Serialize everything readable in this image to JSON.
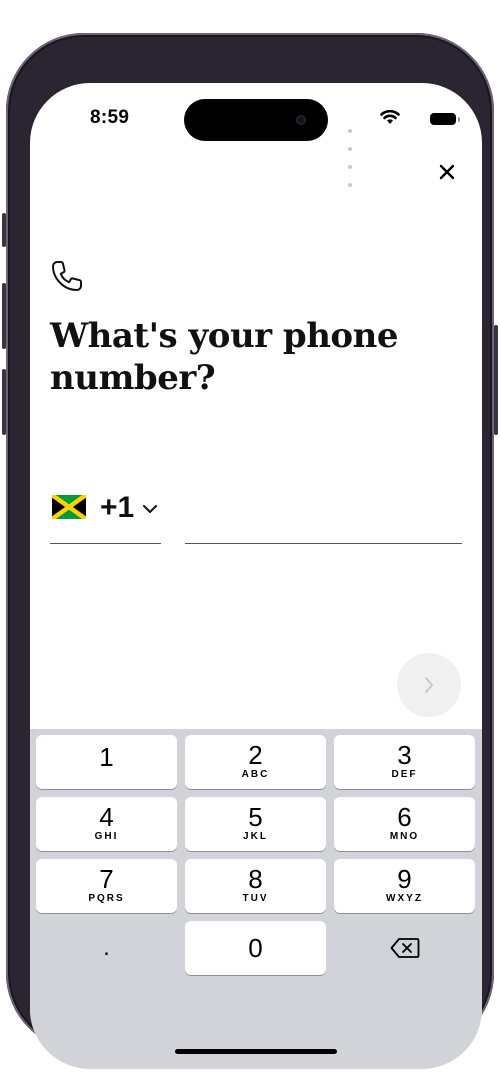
{
  "status_bar": {
    "time": "8:59",
    "icons": [
      "cellular-dots-icon",
      "wifi-icon",
      "battery-icon"
    ]
  },
  "header": {
    "close_icon": "close-icon"
  },
  "main": {
    "icon": "phone-icon",
    "title": "What's your phone number?",
    "country": {
      "flag": "jamaica-flag-icon",
      "dial_code": "+1",
      "chevron": "chevron-down-icon"
    },
    "phone_input": {
      "value": "",
      "placeholder": ""
    },
    "next_button": {
      "icon": "chevron-right-icon",
      "enabled": false
    }
  },
  "keypad": {
    "keys": [
      {
        "num": "1",
        "letters": ""
      },
      {
        "num": "2",
        "letters": "ABC"
      },
      {
        "num": "3",
        "letters": "DEF"
      },
      {
        "num": "4",
        "letters": "GHI"
      },
      {
        "num": "5",
        "letters": "JKL"
      },
      {
        "num": "6",
        "letters": "MNO"
      },
      {
        "num": "7",
        "letters": "PQRS"
      },
      {
        "num": "8",
        "letters": "TUV"
      },
      {
        "num": "9",
        "letters": "WXYZ"
      },
      {
        "num": "0",
        "letters": ""
      }
    ],
    "dot_label": ".",
    "delete_icon": "delete-backspace-icon"
  },
  "colors": {
    "text": "#111111",
    "keypad_bg": "#d1d3d9",
    "key_bg": "#ffffff",
    "next_disabled": "#f0f0f0",
    "flag_green": "#009b3a",
    "flag_gold": "#fed100"
  }
}
